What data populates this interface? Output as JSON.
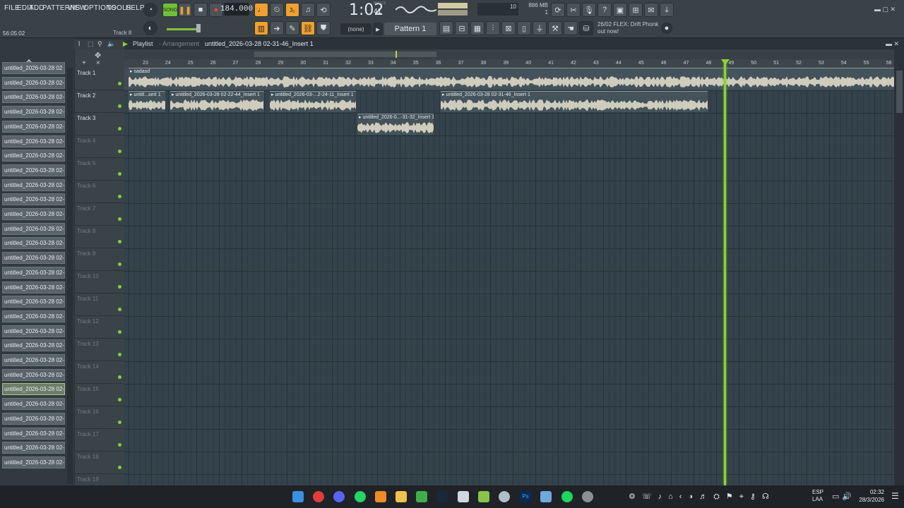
{
  "menu": [
    "FILE",
    "EDIT",
    "ADD",
    "PATTERNS",
    "VIEW",
    "OPTIONS",
    "TOOLS",
    "HELP"
  ],
  "transport": {
    "mode": "SONG",
    "tempo": "184.000",
    "time": "1:02",
    "time_sub": "41",
    "time_label": "M:S:CS"
  },
  "monitor": {
    "cpu": "10",
    "ram": "886 MB",
    "voices": "1"
  },
  "snap": "(none)",
  "pattern": "Pattern 1",
  "news": {
    "line1": "26/02 FLEX: Drift Phonk",
    "line2": "out now!"
  },
  "hint": {
    "position": "56:05:02",
    "track": "Track 8"
  },
  "playlist": {
    "title": "Playlist",
    "subtitle": "- Arrangement",
    "file": "untitled_2026-03-28 02-31-46_Insert 1"
  },
  "browser_items": [
    "untitled_2026-03-28 02",
    "untitled_2026-03-28 02-...",
    "untitled_2026-03-28 02-...",
    "untitled_2026-03-28 02-...",
    "untitled_2026-03-28 02-...",
    "untitled_2026-03-28 02-...",
    "untitled_2026-03-28 02-...",
    "untitled_2026-03-28 02-...",
    "untitled_2026-03-28 02-...",
    "untitled_2026-03-28 02-...",
    "untitled_2026-03-28 02-...",
    "untitled_2026-03-28 02-...",
    "untitled_2026-03-28 02-...",
    "untitled_2026-03-28 02-...",
    "untitled_2026-03-28 02-...",
    "untitled_2026-03-28 02-...",
    "untitled_2026-03-28 02-...",
    "untitled_2026-03-28 02-...",
    "untitled_2026-03-28 02-...",
    "untitled_2026-03-28 02-...",
    "untitled_2026-03-28 02-...",
    "untitled_2026-03-28 02-...",
    "untitled_2026-03-28 02-...",
    "untitled_2026-03-28 02-...",
    "untitled_2026-03-28 02-...",
    "untitled_2026-03-28 02-...",
    "untitled_2026-03-28 02-...",
    "untitled_2026-03-28 02-..."
  ],
  "tracks": [
    "Track 1",
    "Track 2",
    "Track 3",
    "Track 4",
    "Track 5",
    "Track 6",
    "Track 7",
    "Track 8",
    "Track 9",
    "Track 10",
    "Track 11",
    "Track 12",
    "Track 13",
    "Track 14",
    "Track 15",
    "Track 16",
    "Track 17",
    "Track 18",
    "Track 19"
  ],
  "ruler": [
    "23",
    "24",
    "25",
    "26",
    "27",
    "28",
    "29",
    "30",
    "31",
    "32",
    "33",
    "34",
    "35",
    "36",
    "37",
    "38",
    "39",
    "40",
    "41",
    "42",
    "43",
    "44",
    "45",
    "46",
    "47",
    "48",
    "49",
    "50",
    "51",
    "52",
    "53",
    "54",
    "55",
    "56"
  ],
  "clips": [
    {
      "label": "sadasd"
    },
    {
      "label": "untitl...sert 1"
    },
    {
      "label": "untitled_2026-03-28 02-22-44_Insert 1"
    },
    {
      "label": "untitled_2026-03-...2-24-11_Insert 1"
    },
    {
      "label": "untitled_2026-03-28 02-31-46_Insert 1"
    },
    {
      "label": "untitled_2026-0...-31-32_Insert 1"
    }
  ],
  "taskbar": {
    "lang1": "ESP",
    "lang2": "LAA",
    "time": "02:32",
    "date": "28/3/2026"
  }
}
